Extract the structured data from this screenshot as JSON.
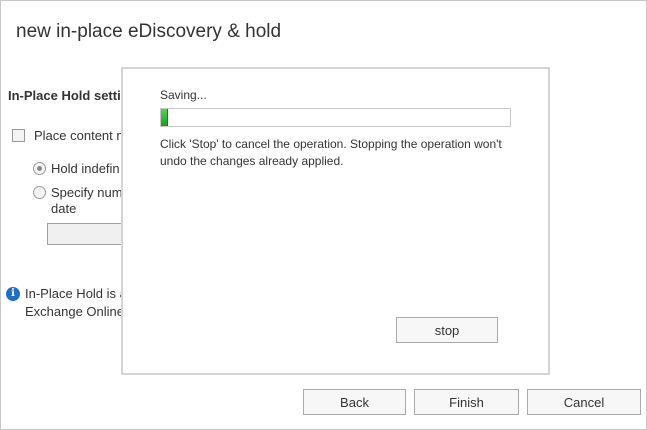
{
  "window": {
    "title": "new in-place eDiscovery & hold"
  },
  "background": {
    "section_heading": "In-Place Hold setti",
    "place_content_label": "Place content m",
    "hold_indefinitely_label": "Hold indefin",
    "specify_number_label_line1": "Specify numl",
    "specify_number_label_line2": "date",
    "date_input_value": "",
    "info_text": "In-Place Hold is a\nExchange Online"
  },
  "dialog": {
    "status_label": "Saving...",
    "progress_fraction": 0.02,
    "message": "Click 'Stop' to cancel the operation. Stopping the operation won't undo the changes already applied.",
    "stop_label": "stop"
  },
  "footer": {
    "back_label": "Back",
    "finish_label": "Finish",
    "cancel_label": "Cancel"
  },
  "colors": {
    "progress_green": "#2db52d",
    "info_blue": "#1f6fc5"
  },
  "icons": {
    "info": "info-icon"
  }
}
